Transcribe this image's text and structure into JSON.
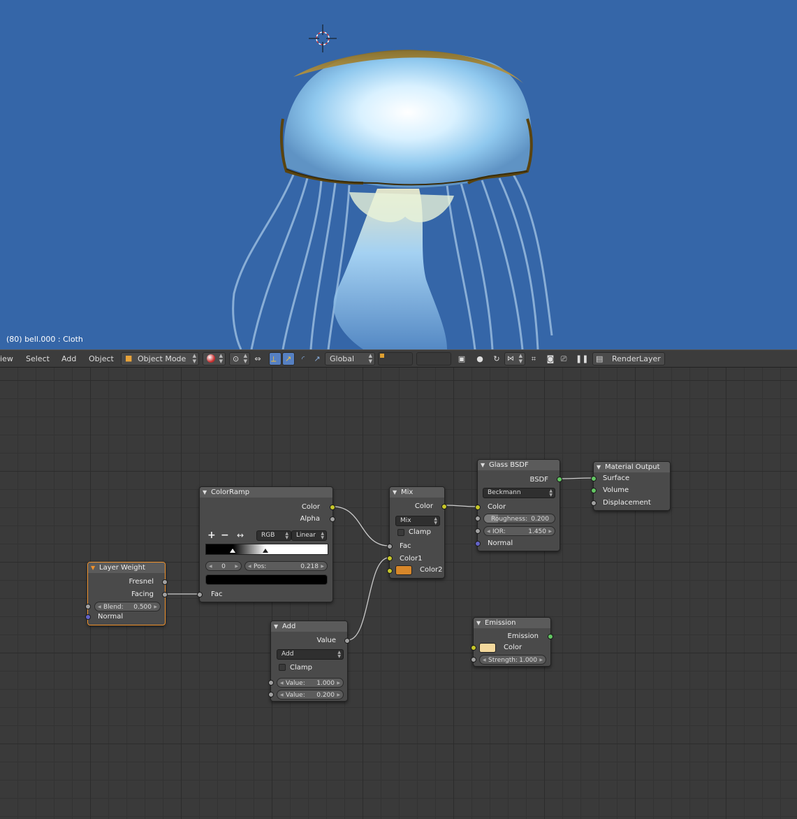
{
  "viewport": {
    "frame_info": "(80) bell.000 : Cloth",
    "background": "#3566a8"
  },
  "toolbar": {
    "menu": [
      "iew",
      "Select",
      "Add",
      "Object"
    ],
    "mode": "Object Mode",
    "orientation": "Global",
    "render_layer": "RenderLayer"
  },
  "nodes": {
    "color_ramp": {
      "title": "ColorRamp",
      "out_color": "Color",
      "out_alpha": "Alpha",
      "add": "+",
      "remove": "−",
      "flip": "↔",
      "color_mode": "RGB",
      "interpolation": "Linear",
      "index": "0",
      "pos_label": "Pos:",
      "pos_value": "0.218",
      "in_fac": "Fac",
      "stops": [
        0.22,
        0.49
      ]
    },
    "layer_weight": {
      "title": "Layer Weight",
      "out_fresnel": "Fresnel",
      "out_facing": "Facing",
      "blend_label": "Blend:",
      "blend_value": "0.500",
      "in_normal": "Normal"
    },
    "mix": {
      "title": "Mix",
      "out_color": "Color",
      "mode": "Mix",
      "clamp": "Clamp",
      "in_fac": "Fac",
      "in_color1": "Color1",
      "in_color2": "Color2",
      "color2_swatch": "#d7872a"
    },
    "glass": {
      "title": "Glass BSDF",
      "out_bsdf": "BSDF",
      "distribution": "Beckmann",
      "in_color": "Color",
      "roughness_label": "Roughness:",
      "roughness_value": "0.200",
      "roughness_fraction": 0.2,
      "ior_label": "IOR:",
      "ior_value": "1.450",
      "in_normal": "Normal"
    },
    "material_output": {
      "title": "Material Output",
      "in_surface": "Surface",
      "in_volume": "Volume",
      "in_displacement": "Displacement"
    },
    "add": {
      "title": "Add",
      "out_value": "Value",
      "operation": "Add",
      "clamp": "Clamp",
      "value1_label": "Value:",
      "value1": "1.000",
      "value2_label": "Value:",
      "value2": "0.200"
    },
    "emission": {
      "title": "Emission",
      "out_emission": "Emission",
      "in_color": "Color",
      "color_swatch": "#f3d89c",
      "strength_label": "Strength:",
      "strength_value": "1.000"
    }
  },
  "colors": {
    "socket_color": "#c7c729",
    "socket_shader": "#63c763",
    "socket_value": "#a1a1a1",
    "socket_vector": "#6363c7",
    "selected_outline": "#f0922d"
  }
}
